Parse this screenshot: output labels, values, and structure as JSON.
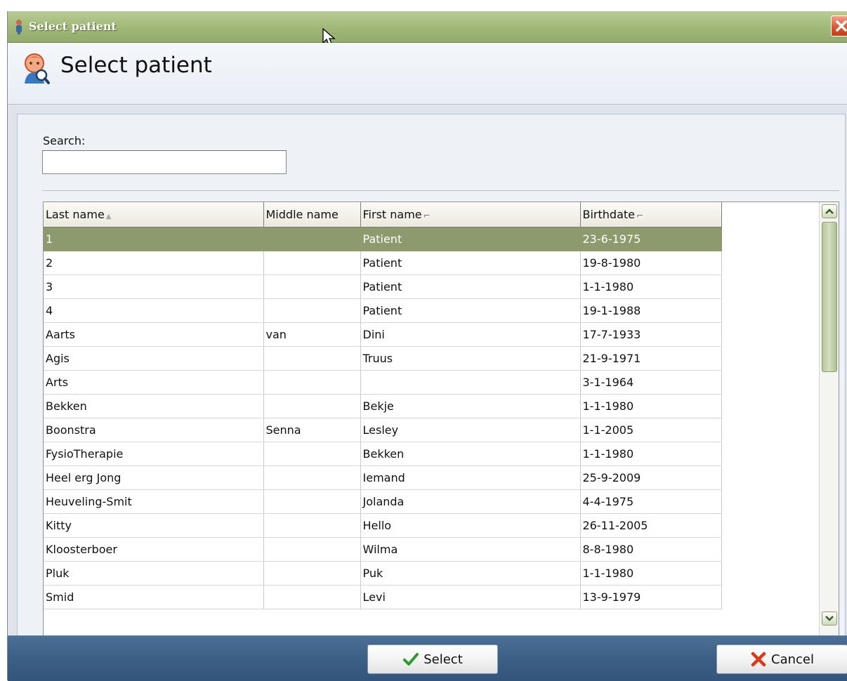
{
  "window": {
    "title": "Select patient",
    "icons": {
      "title": "patient-icon",
      "close": "close-icon"
    }
  },
  "header": {
    "title": "Select patient",
    "icon": "patient-search-icon"
  },
  "search": {
    "label": "Search:",
    "value": "",
    "placeholder": ""
  },
  "grid": {
    "columns": [
      {
        "label": "Last name",
        "indicator": "▲"
      },
      {
        "label": "Middle name",
        "indicator": ""
      },
      {
        "label": "First name",
        "indicator": "⌐"
      },
      {
        "label": "Birthdate",
        "indicator": "⌐"
      }
    ],
    "selected_row": 0,
    "rows": [
      [
        "1",
        "",
        "Patient",
        "23-6-1975"
      ],
      [
        "2",
        "",
        "Patient",
        "19-8-1980"
      ],
      [
        "3",
        "",
        "Patient",
        "1-1-1980"
      ],
      [
        "4",
        "",
        "Patient",
        "19-1-1988"
      ],
      [
        "Aarts",
        "van",
        "Dini",
        "17-7-1933"
      ],
      [
        "Agis",
        "",
        "Truus",
        "21-9-1971"
      ],
      [
        "Arts",
        "",
        "",
        "3-1-1964"
      ],
      [
        "Bekken",
        "",
        "Bekje",
        "1-1-1980"
      ],
      [
        "Boonstra",
        "Senna",
        "Lesley",
        "1-1-2005"
      ],
      [
        "FysioTherapie",
        "",
        "Bekken",
        "1-1-1980"
      ],
      [
        "Heel erg Jong",
        "",
        "Iemand",
        "25-9-2009"
      ],
      [
        "Heuveling-Smit",
        "",
        "Jolanda",
        "4-4-1975"
      ],
      [
        "Kitty",
        "",
        "Hello",
        "26-11-2005"
      ],
      [
        "Kloosterboer",
        "",
        "Wilma",
        "8-8-1980"
      ],
      [
        "Pluk",
        "",
        "Puk",
        "1-1-1980"
      ],
      [
        "Smid",
        "",
        "Levi",
        "13-9-1979"
      ]
    ]
  },
  "footer": {
    "select_label": "Select",
    "cancel_label": "Cancel",
    "icons": {
      "select": "checkmark-icon",
      "cancel": "x-icon"
    }
  },
  "colors": {
    "titlebar": "#a0b777",
    "selected_row": "#8c9a6e",
    "footer": "#3c5f86"
  }
}
